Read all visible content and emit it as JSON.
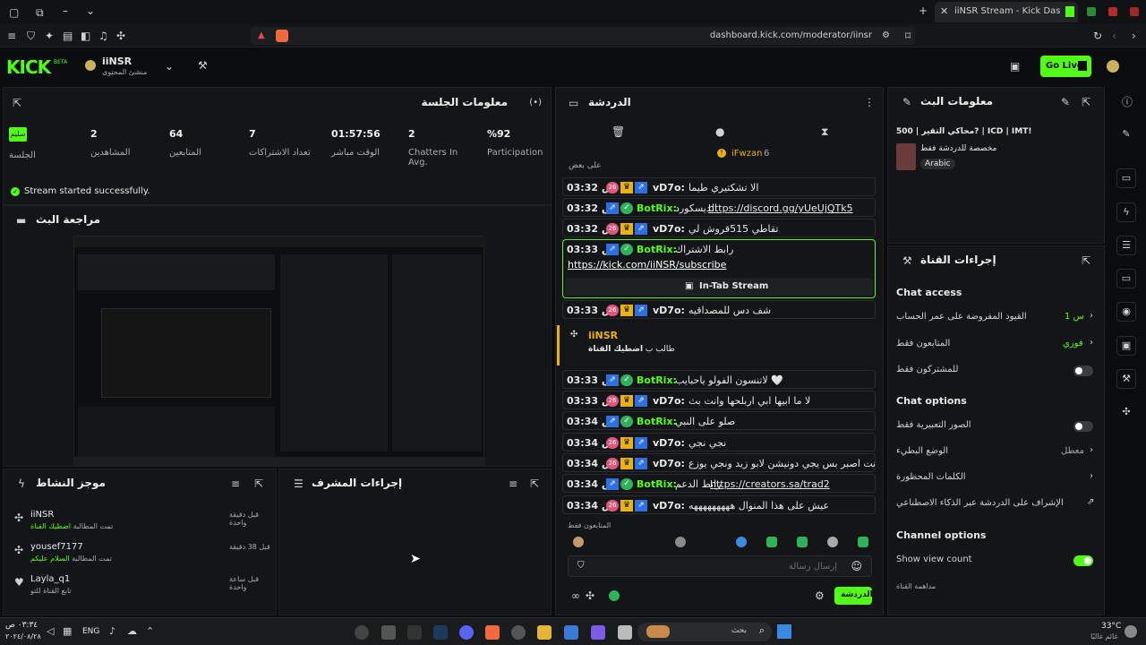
{
  "browser": {
    "tab_title": "iiNSR Stream - Kick Dashboard",
    "url": "dashboard.kick.com/moderator/iinsr"
  },
  "header": {
    "logo": "KICK",
    "logo_badge": "BETA",
    "channel_name": "iiNSR",
    "channel_role": "منشئ المحتوى",
    "go_live_label": "Go Live"
  },
  "session": {
    "title": "معلومات الجلسة",
    "stats": [
      {
        "value": "%92",
        "label": "Participation"
      },
      {
        "value": "2",
        "label": "Chatters In Avg."
      },
      {
        "value": "01:57:56",
        "label": "الوقت مباشر"
      },
      {
        "value": "7",
        "label": "تعداد الاشتراكات"
      },
      {
        "value": "64",
        "label": "المتابعين"
      },
      {
        "value": "2",
        "label": "المشاهدين"
      }
    ],
    "session_badge": "سليم",
    "session_label": "الجلسة",
    "status_text": "Stream started successfully."
  },
  "preview": {
    "title": "مراجعة البث"
  },
  "activity": {
    "title": "موجز النشاط",
    "items": [
      {
        "name": "iiNSR",
        "detail": "تمت المطالبة",
        "detail_accent": "اضطيك القناة",
        "time": "قبل دقيقة واحدة"
      },
      {
        "name": "yousef7177",
        "detail": "تمت المطالبة",
        "detail_accent": "السلام عليكم",
        "time": "قبل 38 دقيقة"
      },
      {
        "name": "Layla_q1",
        "detail": "تابع القناة للتو",
        "detail_accent": "",
        "time": "قبل ساعة واحدة"
      }
    ]
  },
  "mod_actions": {
    "title": "إجراءات المشرف"
  },
  "chat": {
    "title": "الدردشة",
    "pinned_user": "iFwzan",
    "pinned_count": "6",
    "cut_text": "على بعض",
    "messages": [
      {
        "time": "03:32 ص",
        "user": "vD7o:",
        "text": "الا تشكتيري طيما",
        "type": "sub"
      },
      {
        "time": "03:32 ص",
        "user": "BotRix:",
        "text": "الديسكورد",
        "link": "https://discord.gg/yUeUjQTk5",
        "type": "bot"
      },
      {
        "time": "03:32 ص",
        "user": "vD7o:",
        "text": "تقاطي 515قروش لي",
        "type": "sub"
      },
      {
        "time": "03:33 ص",
        "user": "vD7o:",
        "text": "شف دس للمصداقيه",
        "type": "sub"
      },
      {
        "time": "03:33 ص",
        "user": "BotRix:",
        "text": "لاتنسون الفولو ياحبايب 🤍",
        "type": "bot"
      },
      {
        "time": "03:33 ص",
        "user": "vD7o:",
        "text": "لا ما ابيها ابي اربلحها وانت بث",
        "type": "sub"
      },
      {
        "time": "03:34 ص",
        "user": "BotRix:",
        "text": "صلو على النبي",
        "type": "bot"
      },
      {
        "time": "03:34 ص",
        "user": "vD7o:",
        "text": "نجي نجي",
        "type": "sub"
      },
      {
        "time": "03:34 ص",
        "user": "vD7o:",
        "text": "انت اصبر بس يجي دونيشن لابو زيد ونجي يوزع",
        "type": "sub"
      },
      {
        "time": "03:34 ص",
        "user": "BotRix:",
        "text": "رابط الدعم",
        "link": "https://creators.sa/trad2",
        "type": "bot"
      },
      {
        "time": "03:34 ص",
        "user": "vD7o:",
        "text": "عيش على هذا المنوال هههههههههه",
        "type": "sub"
      }
    ],
    "highlight": {
      "time": "03:33 ص",
      "user": "BotRix:",
      "text": "رابط الاشتراك",
      "link": "https://kick.com/iiNSR/subscribe",
      "button": "In-Tab Stream"
    },
    "reward": {
      "user": "iiNSR",
      "text": "طالب ب",
      "accent": "اضطيك القناة"
    },
    "followers_only_label": "المتابعون فقط",
    "input_placeholder": "إرسال رسالة",
    "send_label": "الدردشة"
  },
  "stream_info": {
    "title": "معلومات البث",
    "stream_title": "محاكي التقير | 500? | ICD | IMT!",
    "category": "مخصصة للدردشة فقط",
    "language": "Arabic"
  },
  "channel_actions": {
    "title": "إجراءات القناة",
    "chat_access_heading": "Chat access",
    "rows_access": [
      {
        "label": "القيود المفروضة على عمر الحساب",
        "value": "1 س",
        "control": "chevron"
      },
      {
        "label": "المتابعون فقط",
        "value": "فوري",
        "control": "chevron"
      },
      {
        "label": "للمشتركون فقط",
        "value": "",
        "control": "toggle-off"
      }
    ],
    "chat_options_heading": "Chat options",
    "rows_options": [
      {
        "label": "الصور التعبيرية فقط",
        "value": "",
        "control": "toggle-off"
      },
      {
        "label": "الوضع البطيء",
        "value": "معطل",
        "control": "chevron"
      },
      {
        "label": "الكلمات المحظورة",
        "value": "",
        "control": "chevron"
      },
      {
        "label": "الإشراف على الدردشة عبر الذكاء الاصطناعي",
        "value": "",
        "control": "external"
      }
    ],
    "channel_options_heading": "Channel options",
    "show_view_count": "Show view count",
    "channel_watch": "مداهمة القناة"
  },
  "taskbar": {
    "time": "٠٣:٣٤ ص",
    "date": "٢٠٢٤/٠٨/٢٨",
    "lang": "ENG",
    "search": "بحث",
    "weather_temp": "33°C",
    "weather_text": "غائم غالبًا"
  },
  "colors": {
    "accent": "#53fc18",
    "panel": "#141517",
    "background": "#0b0c0d"
  }
}
